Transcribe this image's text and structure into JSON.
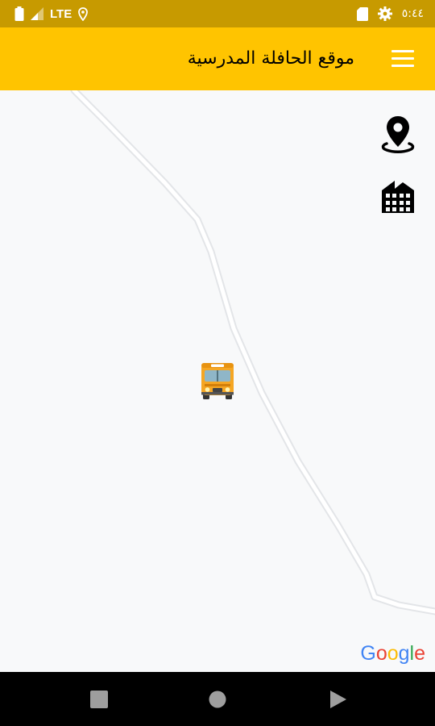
{
  "status_bar": {
    "network": "LTE",
    "time": "٥:٤٤",
    "icons": [
      "battery-icon",
      "signal-icon",
      "location-icon",
      "sd-card-icon",
      "settings-icon"
    ]
  },
  "app_bar": {
    "title": "موقع الحافلة المدرسية",
    "menu_icon": "hamburger-menu-icon",
    "background_color": "#ffc400"
  },
  "map": {
    "controls": [
      {
        "name": "my-location-button",
        "icon": "map-pin-icon"
      },
      {
        "name": "school-button",
        "icon": "building-icon"
      }
    ],
    "marker": "school-bus-icon",
    "attribution": {
      "letters": [
        "G",
        "o",
        "o",
        "g",
        "l",
        "e"
      ],
      "colors": [
        "#4285f4",
        "#ea4335",
        "#fbbc05",
        "#4285f4",
        "#34a853",
        "#ea4335"
      ]
    }
  },
  "nav_bar": {
    "buttons": [
      "recent-apps-icon",
      "home-icon",
      "back-icon"
    ]
  }
}
